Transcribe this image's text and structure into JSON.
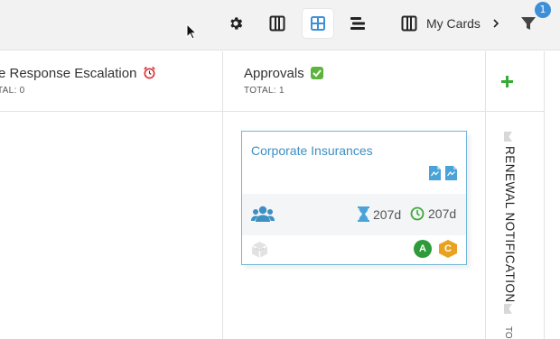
{
  "toolbar": {
    "settings_icon": "gear-icon",
    "column_view_icon": "columns-icon",
    "grid_view_icon": "grid-icon",
    "list_view_icon": "rows-icon",
    "mycards_label": "My Cards",
    "filter_icon": "filter-icon",
    "filter_badge": "1",
    "accent_color": "#3d8fd6"
  },
  "columns": [
    {
      "title": "e Response Escalation",
      "emoji": "alarm-clock-icon",
      "total": "TAL: 0"
    },
    {
      "title": "Approvals",
      "emoji": "check-mark-icon",
      "total": "TOTAL: 1"
    }
  ],
  "add_column_icon": "plus-icon",
  "card": {
    "title": "Corporate Insurances",
    "duration_1": "207d",
    "duration_2": "207d",
    "avatar_1": "A",
    "avatar_2": "C",
    "border_color": "#6fb6d6"
  },
  "collapsed_column": {
    "title": "RENEWAL NOTIFICATION",
    "total": "TO"
  }
}
